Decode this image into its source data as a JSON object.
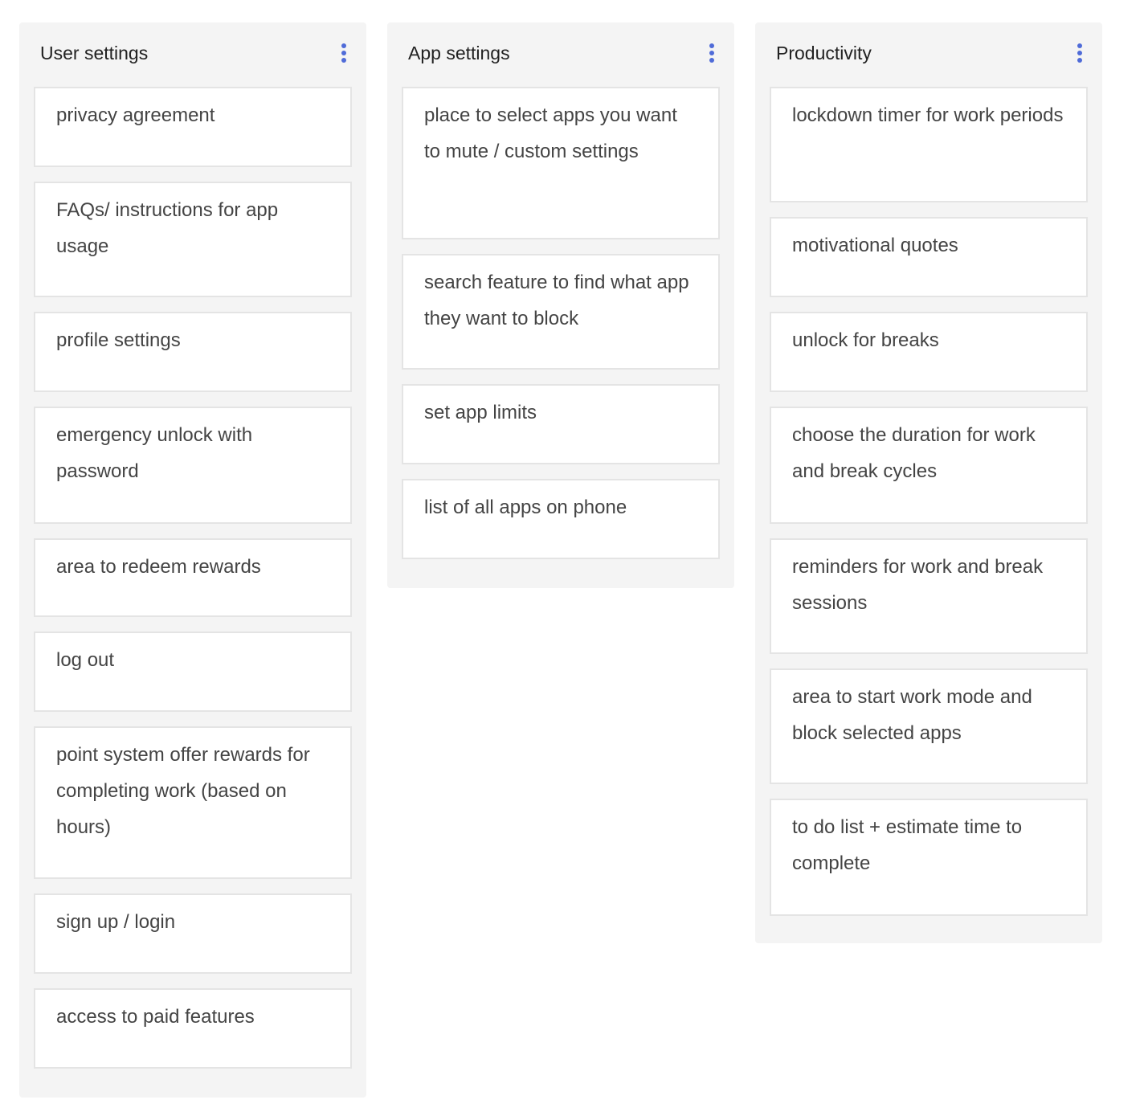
{
  "columns": [
    {
      "title": "User settings",
      "menu_icon": "vertical-dots-icon",
      "cards": [
        "privacy agreement",
        "FAQs/ instructions for app usage",
        "profile settings",
        "emergency unlock with password",
        "area to redeem rewards",
        "log out",
        "point system offer rewards for completing work (based on hours)",
        "sign up / login",
        "access to paid features"
      ]
    },
    {
      "title": "App settings",
      "menu_icon": "vertical-dots-icon",
      "cards": [
        "place to select apps you want to mute / custom settings",
        "search feature to find what app they want to block",
        "set app limits",
        "list of all apps on phone"
      ]
    },
    {
      "title": "Productivity",
      "menu_icon": "vertical-dots-icon",
      "cards": [
        "lockdown timer for work periods",
        "motivational quotes",
        "unlock for breaks",
        "choose the duration for work and break cycles",
        "reminders for work and break sessions",
        "area to start work mode and block selected apps",
        "to do list + estimate time to complete"
      ]
    }
  ],
  "colors": {
    "column_bg": "#f4f4f4",
    "card_bg": "#ffffff",
    "card_border": "#e4e4e4",
    "menu_dots": "#4f6bd8",
    "title_text": "#222222",
    "card_text": "#444444"
  }
}
